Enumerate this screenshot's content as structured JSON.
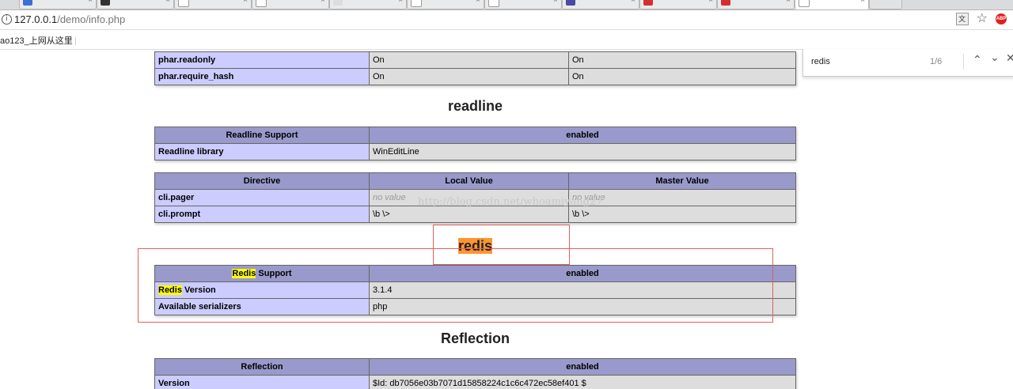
{
  "browser": {
    "address": {
      "host": "127.0.0.1",
      "path": "/demo/info.php"
    },
    "bookmark": "ao123_上网从这里",
    "find": {
      "query": "redis",
      "count": "1/6"
    },
    "icons": {
      "info": "info-icon",
      "translate": "translate-icon",
      "star": "star-icon",
      "abp": "adblock-plus-icon"
    }
  },
  "phpinfo": {
    "phar_rows": [
      {
        "name": "phar.readonly",
        "local": "On",
        "master": "On"
      },
      {
        "name": "phar.require_hash",
        "local": "On",
        "master": "On"
      }
    ],
    "readline": {
      "title": "readline",
      "support_label": "Readline Support",
      "support_value": "enabled",
      "library_label": "Readline library",
      "library_value": "WinEditLine",
      "directive_header": "Directive",
      "local_header": "Local Value",
      "master_header": "Master Value",
      "rows": [
        {
          "name": "cli.pager",
          "local": "no value",
          "master": "no value"
        },
        {
          "name": "cli.prompt",
          "local": "\\b \\>",
          "master": "\\b \\>"
        }
      ]
    },
    "redis": {
      "title": "redis",
      "support_label_hl": "Redis",
      "support_label_rest": " Support",
      "support_value": "enabled",
      "version_label_hl": "Redis",
      "version_label_rest": " Version",
      "version_value": "3.1.4",
      "serializers_label": "Available serializers",
      "serializers_value": "php"
    },
    "reflection": {
      "title": "Reflection",
      "header_label": "Reflection",
      "header_value": "enabled",
      "version_label": "Version",
      "version_value": "$Id: db7056e03b7071d15858224c1c6c472ec58ef401 $"
    }
  },
  "watermark": "http://blog.csdn.net/whoamiyang27",
  "colors": {
    "annotation_box": "#e06060",
    "search_highlight": "#ffff00",
    "active_match": "#ff9632"
  }
}
